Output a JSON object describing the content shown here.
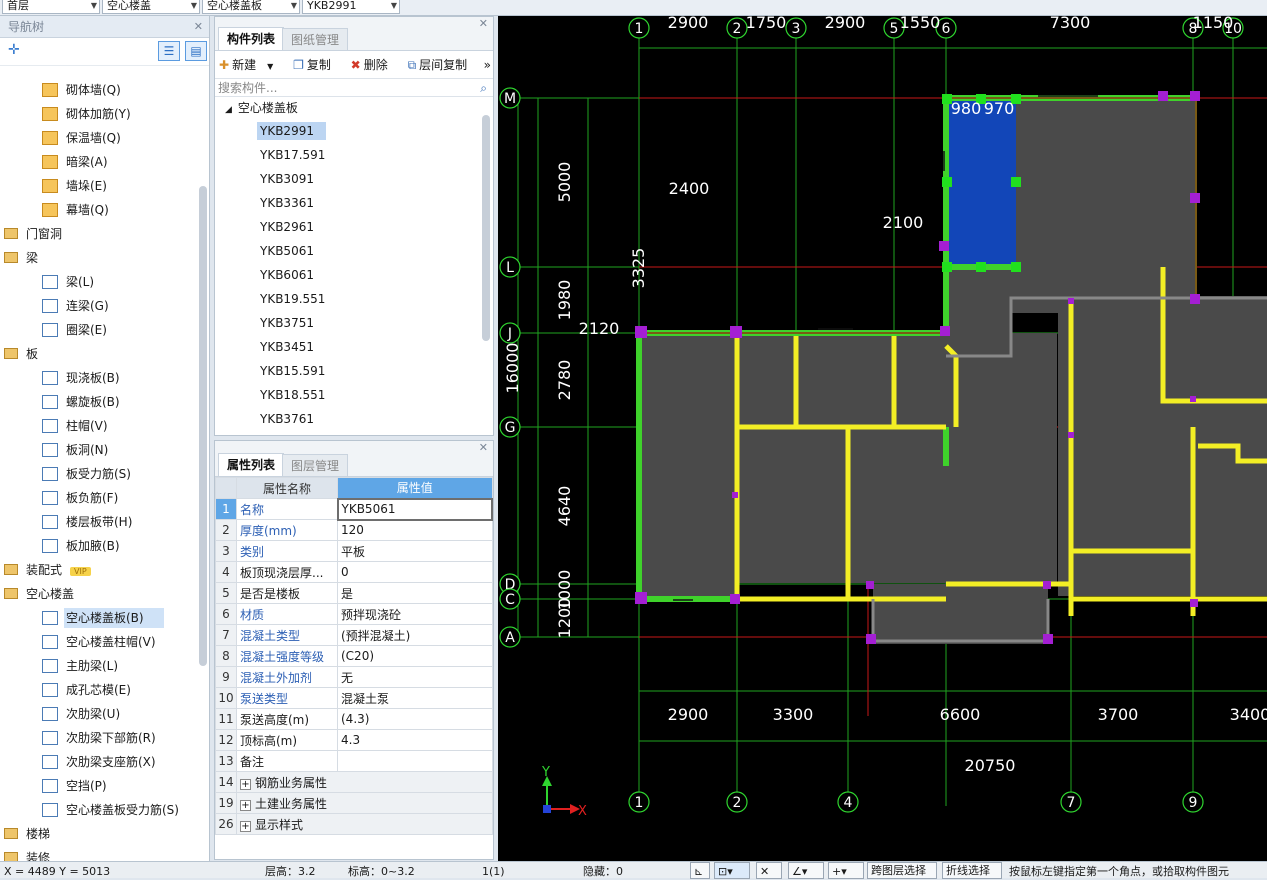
{
  "topbar": {
    "floor": "首层",
    "category": "空心楼盖",
    "type": "空心楼盖板",
    "item": "YKB2991"
  },
  "nav": {
    "title": "导航树",
    "items": [
      {
        "label": "砌体墙(Q)",
        "level": 2,
        "icon": "masonry-wall-icon"
      },
      {
        "label": "砌体加筋(Y)",
        "level": 2,
        "icon": "masonry-rebar-icon"
      },
      {
        "label": "保温墙(Q)",
        "level": 2,
        "icon": "insulation-wall-icon"
      },
      {
        "label": "暗梁(A)",
        "level": 2,
        "icon": "hidden-beam-icon"
      },
      {
        "label": "墙垛(E)",
        "level": 2,
        "icon": "wall-pier-icon"
      },
      {
        "label": "幕墙(Q)",
        "level": 2,
        "icon": "curtain-wall-icon"
      },
      {
        "label": "门窗洞",
        "level": 1,
        "icon": "folder-icon"
      },
      {
        "label": "梁",
        "level": 1,
        "icon": "folder-icon"
      },
      {
        "label": "梁(L)",
        "level": 2,
        "icon": "beam-icon"
      },
      {
        "label": "连梁(G)",
        "level": 2,
        "icon": "coupling-beam-icon"
      },
      {
        "label": "圈梁(E)",
        "level": 2,
        "icon": "ring-beam-icon"
      },
      {
        "label": "板",
        "level": 1,
        "icon": "folder-icon"
      },
      {
        "label": "现浇板(B)",
        "level": 2,
        "icon": "cast-slab-icon"
      },
      {
        "label": "螺旋板(B)",
        "level": 2,
        "icon": "spiral-slab-icon"
      },
      {
        "label": "柱帽(V)",
        "level": 2,
        "icon": "column-cap-icon"
      },
      {
        "label": "板洞(N)",
        "level": 2,
        "icon": "slab-hole-icon"
      },
      {
        "label": "板受力筋(S)",
        "level": 2,
        "icon": "slab-main-rebar-icon"
      },
      {
        "label": "板负筋(F)",
        "level": 2,
        "icon": "slab-negative-rebar-icon"
      },
      {
        "label": "楼层板带(H)",
        "level": 2,
        "icon": "slab-strip-icon"
      },
      {
        "label": "板加腋(B)",
        "level": 2,
        "icon": "slab-haunch-icon"
      },
      {
        "label": "装配式",
        "level": 1,
        "icon": "folder-icon",
        "badge": "VIP"
      },
      {
        "label": "空心楼盖",
        "level": 1,
        "icon": "folder-icon"
      },
      {
        "label": "空心楼盖板(B)",
        "level": 2,
        "icon": "hollow-slab-icon",
        "selected": true
      },
      {
        "label": "空心楼盖柱帽(V)",
        "level": 2,
        "icon": "hollow-column-cap-icon"
      },
      {
        "label": "主肋梁(L)",
        "level": 2,
        "icon": "main-rib-beam-icon"
      },
      {
        "label": "成孔芯模(E)",
        "level": 2,
        "icon": "core-mold-icon"
      },
      {
        "label": "次肋梁(U)",
        "level": 2,
        "icon": "secondary-rib-beam-icon"
      },
      {
        "label": "次肋梁下部筋(R)",
        "level": 2,
        "icon": "rib-bottom-rebar-icon"
      },
      {
        "label": "次肋梁支座筋(X)",
        "level": 2,
        "icon": "rib-support-rebar-icon"
      },
      {
        "label": "空挡(P)",
        "level": 2,
        "icon": "void-icon"
      },
      {
        "label": "空心楼盖板受力筋(S)",
        "level": 2,
        "icon": "hollow-slab-rebar-icon"
      },
      {
        "label": "楼梯",
        "level": 1,
        "icon": "folder-icon"
      },
      {
        "label": "装修",
        "level": 1,
        "icon": "folder-icon"
      }
    ]
  },
  "components": {
    "tab_active": "构件列表",
    "tab_other": "图纸管理",
    "toolbar": {
      "new": "新建",
      "copy": "复制",
      "delete": "删除",
      "floor_copy": "层间复制"
    },
    "search_placeholder": "搜索构件...",
    "group": "空心楼盖板",
    "items": [
      "YKB2991",
      "YKB17.591",
      "YKB3091",
      "YKB3361",
      "YKB2961",
      "YKB5061",
      "YKB6061",
      "YKB19.551",
      "YKB3751",
      "YKB3451",
      "YKB15.591",
      "YKB18.551",
      "YKB3761"
    ]
  },
  "properties": {
    "tab_active": "属性列表",
    "tab_other": "图层管理",
    "col_name": "属性名称",
    "col_value": "属性值",
    "rows": [
      {
        "n": "1",
        "k": "名称",
        "v": "YKB5061",
        "blue": true
      },
      {
        "n": "2",
        "k": "厚度(mm)",
        "v": "120",
        "blue": true
      },
      {
        "n": "3",
        "k": "类别",
        "v": "平板",
        "blue": true
      },
      {
        "n": "4",
        "k": "板顶现浇层厚...",
        "v": "0",
        "blue": false
      },
      {
        "n": "5",
        "k": "是否是楼板",
        "v": "是",
        "blue": false
      },
      {
        "n": "6",
        "k": "材质",
        "v": "预拌现浇砼",
        "blue": true
      },
      {
        "n": "7",
        "k": "混凝土类型",
        "v": "(预拌混凝土)",
        "blue": true
      },
      {
        "n": "8",
        "k": "混凝土强度等级",
        "v": "(C20)",
        "blue": true
      },
      {
        "n": "9",
        "k": "混凝土外加剂",
        "v": "无",
        "blue": true
      },
      {
        "n": "10",
        "k": "泵送类型",
        "v": "混凝土泵",
        "blue": true
      },
      {
        "n": "11",
        "k": "泵送高度(m)",
        "v": "(4.3)",
        "blue": false
      },
      {
        "n": "12",
        "k": "顶标高(m)",
        "v": "4.3",
        "blue": false
      },
      {
        "n": "13",
        "k": "备注",
        "v": "",
        "blue": false
      }
    ],
    "groups": [
      {
        "n": "14",
        "k": "钢筋业务属性"
      },
      {
        "n": "19",
        "k": "土建业务属性"
      },
      {
        "n": "26",
        "k": "显示样式"
      }
    ]
  },
  "drawing": {
    "axes_top": [
      "1",
      "2",
      "3",
      "5",
      "6",
      "8",
      "10"
    ],
    "axes_bottom": [
      "1",
      "2",
      "4",
      "7",
      "9"
    ],
    "axes_left": [
      "M",
      "L",
      "J",
      "G",
      "D",
      "C",
      "A"
    ],
    "dims_top": [
      "2900",
      "1750",
      "2900",
      "1550",
      "7300",
      "1150"
    ],
    "dims_bottom": [
      "2900",
      "3300",
      "6600",
      "3700",
      "3400"
    ],
    "dim_total_bottom": "20750",
    "dims_left": [
      "5000",
      "1980",
      "2780",
      "4640",
      "1000",
      "1200"
    ],
    "dim_total_left": "16000",
    "annotations": [
      "2400",
      "3325",
      "2100",
      "2120",
      "980",
      "970"
    ],
    "axis_x_label": "X",
    "axis_y_label": "Y"
  },
  "status": {
    "coords": "X = 4489 Y = 5013",
    "floor_height": "层高：3.2",
    "elevation": "标高：0~3.2",
    "count": "1(1)",
    "hidden": "隐藏：0",
    "cross_layer": "跨图层选择",
    "polyline_select": "折线选择",
    "hint": "按鼠标左键指定第一个角点，或拾取构件图元"
  }
}
